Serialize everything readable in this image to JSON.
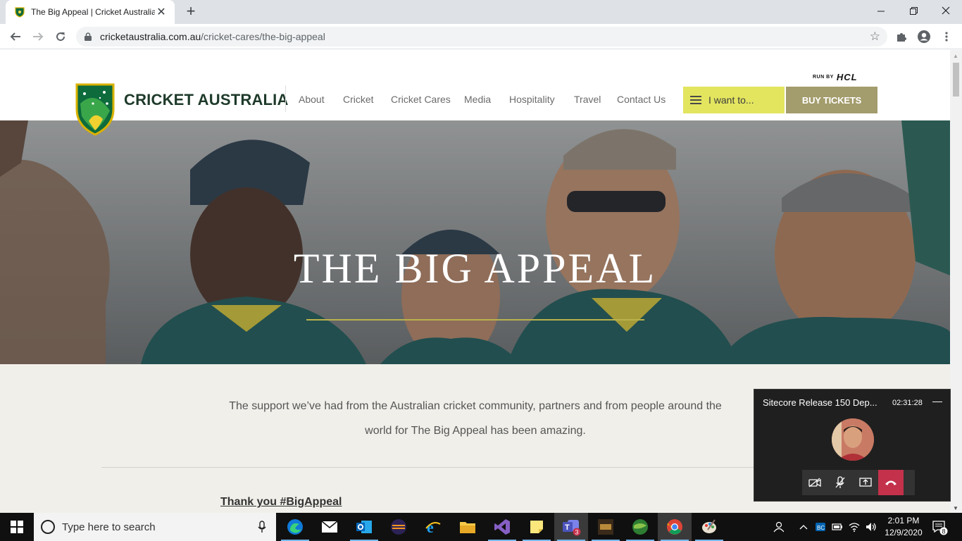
{
  "browser": {
    "tab_title": "The Big Appeal | Cricket Australia",
    "url_host": "cricketaustralia.com.au",
    "url_path": "/cricket-cares/the-big-appeal"
  },
  "header": {
    "run_by": "RUN BY",
    "run_by_brand": "HCL",
    "brand": "CRICKET AUSTRALIA",
    "nav": [
      "About",
      "Cricket",
      "Cricket Cares",
      "Media",
      "Hospitality",
      "Travel",
      "Contact Us"
    ],
    "i_want_label": "I want to...",
    "buy_tickets_label": "BUY TICKETS"
  },
  "hero": {
    "title": "THE BIG APPEAL"
  },
  "content": {
    "intro_line1": "The support we’ve had from the Australian cricket community, partners and from people around the",
    "intro_line2": "world for The Big Appeal has been amazing.",
    "thanks_link": "Thank you #BigAppeal "
  },
  "teams": {
    "meeting_title": "Sitecore Release 150 Dep...",
    "duration": "02:31:28"
  },
  "taskbar": {
    "search_placeholder": "Type here to search",
    "teams_badge": "3",
    "time": "2:01 PM",
    "date": "12/9/2020",
    "notification_count": "8"
  },
  "colors": {
    "accent_yellow": "#e3e55f",
    "buy_gold": "#a39c6c",
    "brand_green": "#1e3a2a",
    "hangup_red": "#c4314b"
  }
}
